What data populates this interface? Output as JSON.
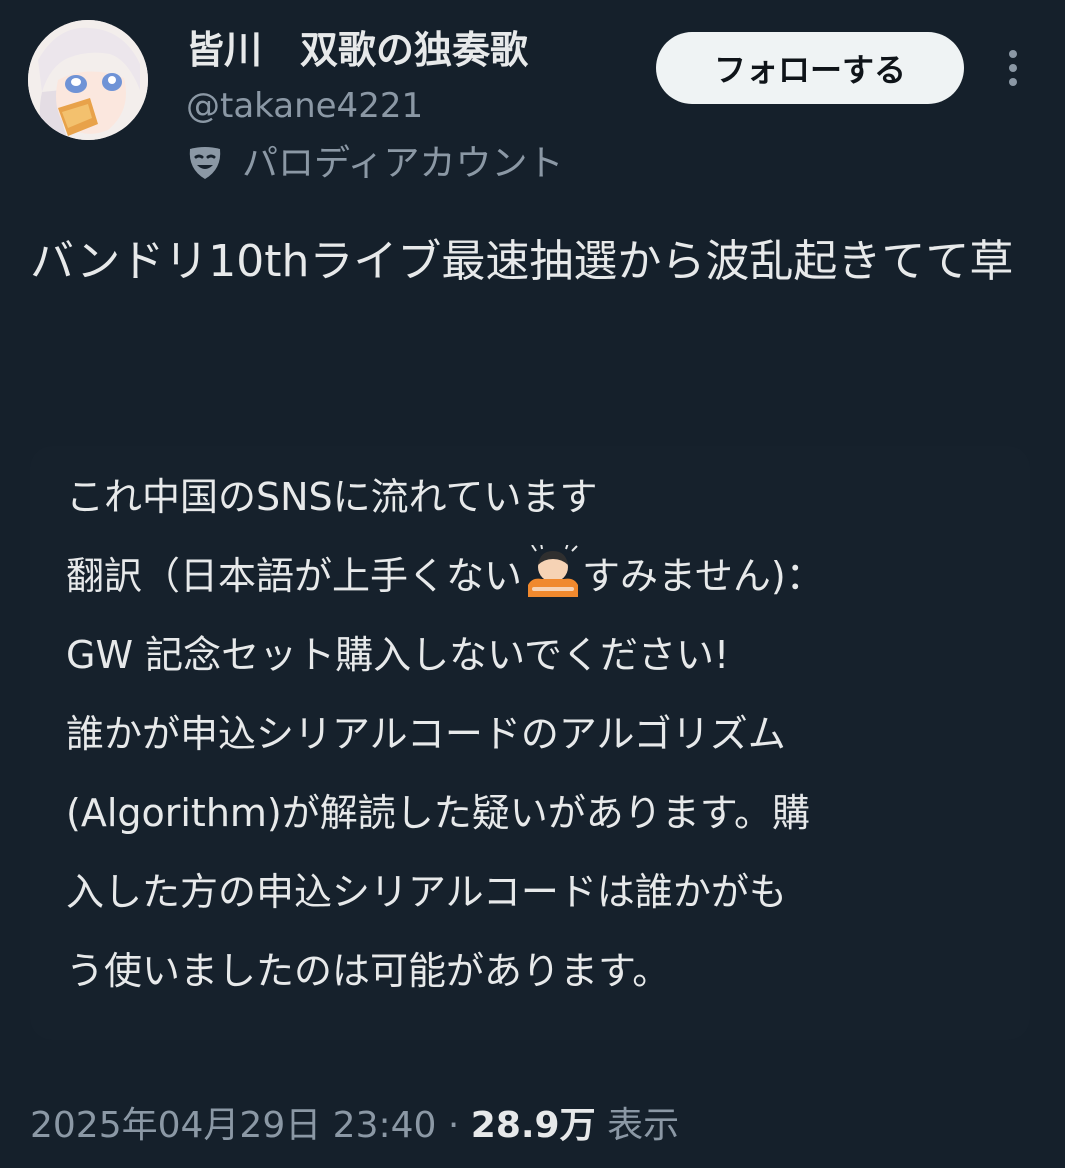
{
  "header": {
    "display_name": "皆川　双歌の独奏歌",
    "handle": "@takane4221",
    "parody_label": "パロディアカウント",
    "parody_icon": "theater-mask-icon",
    "follow_label": "フォローする",
    "more_icon": "more-vertical-icon"
  },
  "tweet": {
    "text": "バンドリ10thライブ最速抽選から波乱起きてて草"
  },
  "quote": {
    "line1": "これ中国のSNSに流れています",
    "line2_before": "翻訳（日本語が上手くない",
    "line2_icon": "bowing-person-icon",
    "line2_after": "すみません)：",
    "line3": "GW 記念セット購入しないでください!",
    "line4": "誰かが申込シリアルコードのアルゴリズム",
    "line5": "(Algorithm)が解読した疑いがあります。購",
    "line6": "入した方の申込シリアルコードは誰かがも",
    "line7": "う使いましたのは可能があります。"
  },
  "meta": {
    "timestamp": "2025年04月29日 23:40",
    "separator": " · ",
    "views_count": "28.9万",
    "views_label": "表示"
  },
  "colors": {
    "background": "#15202b",
    "text_primary": "#e7e9ea",
    "text_secondary": "#8b98a5",
    "button_bg": "#eff3f4"
  }
}
